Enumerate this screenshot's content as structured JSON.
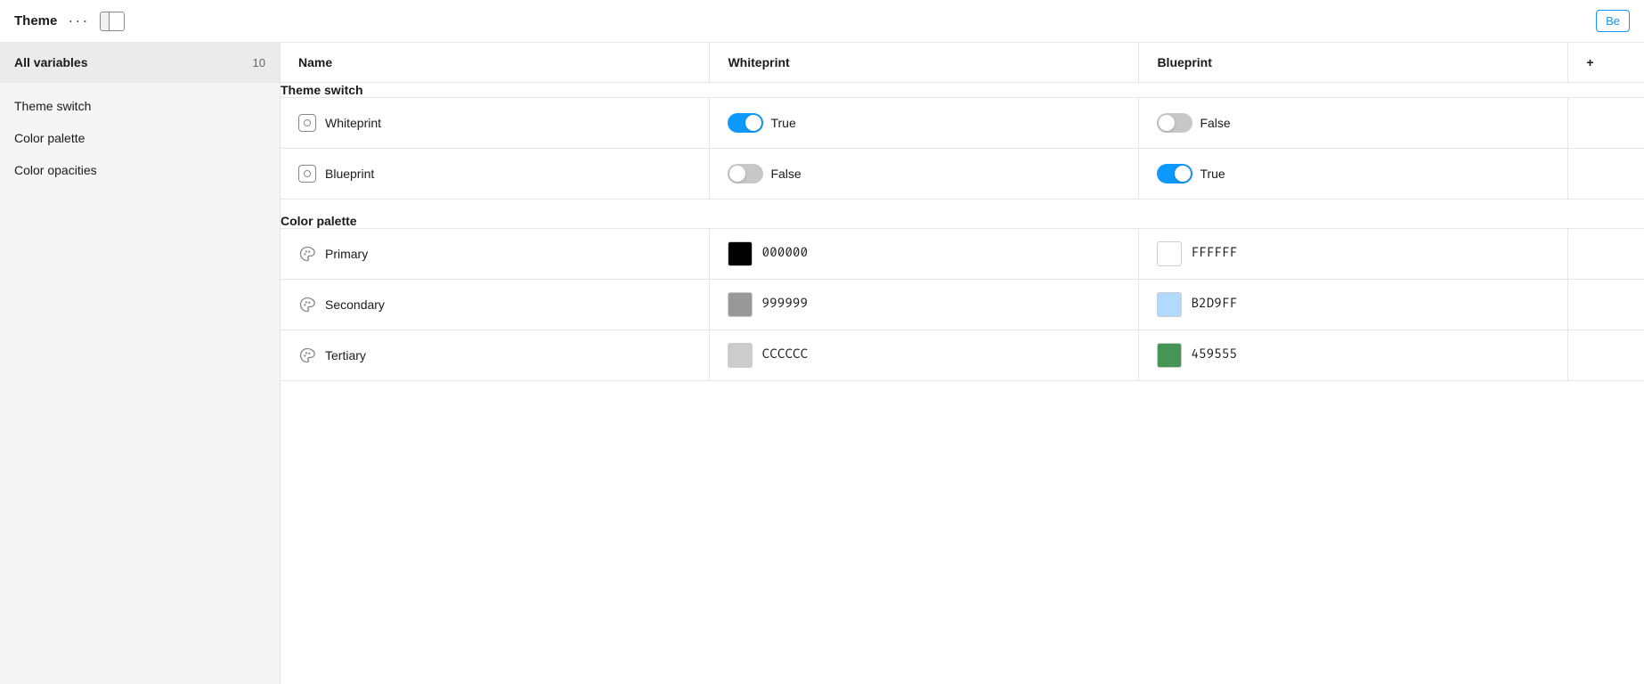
{
  "topbar": {
    "title": "Theme",
    "dots": "···",
    "beta_label": "Be"
  },
  "sidebar": {
    "all_variables_label": "All variables",
    "all_variables_count": "10",
    "items": [
      {
        "label": "Theme switch"
      },
      {
        "label": "Color palette"
      },
      {
        "label": "Color opacities"
      }
    ]
  },
  "table": {
    "columns": {
      "name": "Name",
      "whiteprint": "Whiteprint",
      "blueprint": "Blueprint",
      "add": "+"
    },
    "sections": [
      {
        "header": "Theme switch",
        "rows": [
          {
            "icon_type": "variable",
            "name": "Whiteprint",
            "whiteprint_toggle": true,
            "whiteprint_label": "True",
            "blueprint_toggle": false,
            "blueprint_label": "False"
          },
          {
            "icon_type": "variable",
            "name": "Blueprint",
            "whiteprint_toggle": false,
            "whiteprint_label": "False",
            "blueprint_toggle": true,
            "blueprint_label": "True"
          }
        ]
      },
      {
        "header": "Color palette",
        "rows": [
          {
            "icon_type": "palette",
            "name": "Primary",
            "whiteprint_color": "#000000",
            "whiteprint_hex": "000000",
            "blueprint_color": "#FFFFFF",
            "blueprint_hex": "FFFFFF"
          },
          {
            "icon_type": "palette",
            "name": "Secondary",
            "whiteprint_color": "#999999",
            "whiteprint_hex": "999999",
            "blueprint_color": "#B2D9FF",
            "blueprint_hex": "B2D9FF"
          },
          {
            "icon_type": "palette",
            "name": "Tertiary",
            "whiteprint_color": "#CCCCCC",
            "whiteprint_hex": "CCCCCC",
            "blueprint_color": "#459555",
            "blueprint_hex": "459555"
          }
        ]
      }
    ]
  }
}
